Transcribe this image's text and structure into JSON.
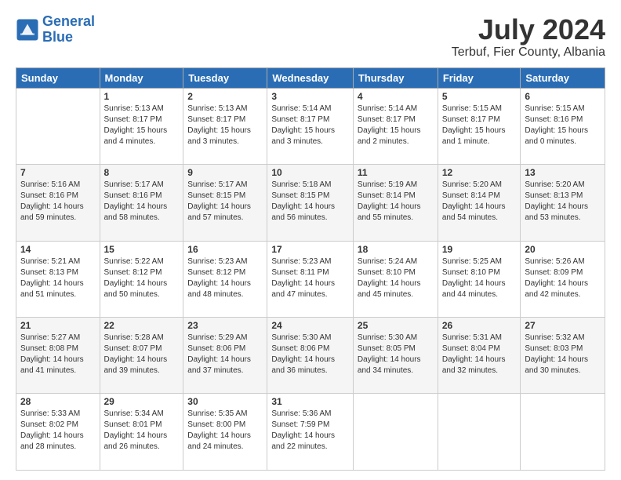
{
  "header": {
    "logo_line1": "General",
    "logo_line2": "Blue",
    "month": "July 2024",
    "location": "Terbuf, Fier County, Albania"
  },
  "weekdays": [
    "Sunday",
    "Monday",
    "Tuesday",
    "Wednesday",
    "Thursday",
    "Friday",
    "Saturday"
  ],
  "rows": [
    [
      {
        "day": "",
        "info": ""
      },
      {
        "day": "1",
        "info": "Sunrise: 5:13 AM\nSunset: 8:17 PM\nDaylight: 15 hours\nand 4 minutes."
      },
      {
        "day": "2",
        "info": "Sunrise: 5:13 AM\nSunset: 8:17 PM\nDaylight: 15 hours\nand 3 minutes."
      },
      {
        "day": "3",
        "info": "Sunrise: 5:14 AM\nSunset: 8:17 PM\nDaylight: 15 hours\nand 3 minutes."
      },
      {
        "day": "4",
        "info": "Sunrise: 5:14 AM\nSunset: 8:17 PM\nDaylight: 15 hours\nand 2 minutes."
      },
      {
        "day": "5",
        "info": "Sunrise: 5:15 AM\nSunset: 8:17 PM\nDaylight: 15 hours\nand 1 minute."
      },
      {
        "day": "6",
        "info": "Sunrise: 5:15 AM\nSunset: 8:16 PM\nDaylight: 15 hours\nand 0 minutes."
      }
    ],
    [
      {
        "day": "7",
        "info": "Sunrise: 5:16 AM\nSunset: 8:16 PM\nDaylight: 14 hours\nand 59 minutes."
      },
      {
        "day": "8",
        "info": "Sunrise: 5:17 AM\nSunset: 8:16 PM\nDaylight: 14 hours\nand 58 minutes."
      },
      {
        "day": "9",
        "info": "Sunrise: 5:17 AM\nSunset: 8:15 PM\nDaylight: 14 hours\nand 57 minutes."
      },
      {
        "day": "10",
        "info": "Sunrise: 5:18 AM\nSunset: 8:15 PM\nDaylight: 14 hours\nand 56 minutes."
      },
      {
        "day": "11",
        "info": "Sunrise: 5:19 AM\nSunset: 8:14 PM\nDaylight: 14 hours\nand 55 minutes."
      },
      {
        "day": "12",
        "info": "Sunrise: 5:20 AM\nSunset: 8:14 PM\nDaylight: 14 hours\nand 54 minutes."
      },
      {
        "day": "13",
        "info": "Sunrise: 5:20 AM\nSunset: 8:13 PM\nDaylight: 14 hours\nand 53 minutes."
      }
    ],
    [
      {
        "day": "14",
        "info": "Sunrise: 5:21 AM\nSunset: 8:13 PM\nDaylight: 14 hours\nand 51 minutes."
      },
      {
        "day": "15",
        "info": "Sunrise: 5:22 AM\nSunset: 8:12 PM\nDaylight: 14 hours\nand 50 minutes."
      },
      {
        "day": "16",
        "info": "Sunrise: 5:23 AM\nSunset: 8:12 PM\nDaylight: 14 hours\nand 48 minutes."
      },
      {
        "day": "17",
        "info": "Sunrise: 5:23 AM\nSunset: 8:11 PM\nDaylight: 14 hours\nand 47 minutes."
      },
      {
        "day": "18",
        "info": "Sunrise: 5:24 AM\nSunset: 8:10 PM\nDaylight: 14 hours\nand 45 minutes."
      },
      {
        "day": "19",
        "info": "Sunrise: 5:25 AM\nSunset: 8:10 PM\nDaylight: 14 hours\nand 44 minutes."
      },
      {
        "day": "20",
        "info": "Sunrise: 5:26 AM\nSunset: 8:09 PM\nDaylight: 14 hours\nand 42 minutes."
      }
    ],
    [
      {
        "day": "21",
        "info": "Sunrise: 5:27 AM\nSunset: 8:08 PM\nDaylight: 14 hours\nand 41 minutes."
      },
      {
        "day": "22",
        "info": "Sunrise: 5:28 AM\nSunset: 8:07 PM\nDaylight: 14 hours\nand 39 minutes."
      },
      {
        "day": "23",
        "info": "Sunrise: 5:29 AM\nSunset: 8:06 PM\nDaylight: 14 hours\nand 37 minutes."
      },
      {
        "day": "24",
        "info": "Sunrise: 5:30 AM\nSunset: 8:06 PM\nDaylight: 14 hours\nand 36 minutes."
      },
      {
        "day": "25",
        "info": "Sunrise: 5:30 AM\nSunset: 8:05 PM\nDaylight: 14 hours\nand 34 minutes."
      },
      {
        "day": "26",
        "info": "Sunrise: 5:31 AM\nSunset: 8:04 PM\nDaylight: 14 hours\nand 32 minutes."
      },
      {
        "day": "27",
        "info": "Sunrise: 5:32 AM\nSunset: 8:03 PM\nDaylight: 14 hours\nand 30 minutes."
      }
    ],
    [
      {
        "day": "28",
        "info": "Sunrise: 5:33 AM\nSunset: 8:02 PM\nDaylight: 14 hours\nand 28 minutes."
      },
      {
        "day": "29",
        "info": "Sunrise: 5:34 AM\nSunset: 8:01 PM\nDaylight: 14 hours\nand 26 minutes."
      },
      {
        "day": "30",
        "info": "Sunrise: 5:35 AM\nSunset: 8:00 PM\nDaylight: 14 hours\nand 24 minutes."
      },
      {
        "day": "31",
        "info": "Sunrise: 5:36 AM\nSunset: 7:59 PM\nDaylight: 14 hours\nand 22 minutes."
      },
      {
        "day": "",
        "info": ""
      },
      {
        "day": "",
        "info": ""
      },
      {
        "day": "",
        "info": ""
      }
    ]
  ]
}
